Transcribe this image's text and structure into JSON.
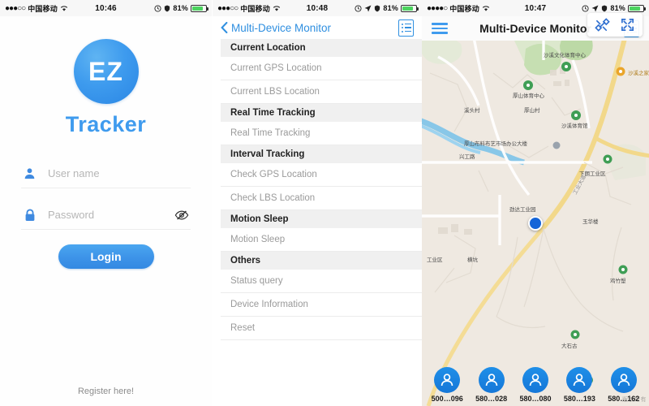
{
  "statusbars": {
    "carrier": "中国移动",
    "battery": "81%",
    "times": {
      "login": "10:46",
      "menu": "10:48",
      "map": "10:47"
    }
  },
  "login": {
    "logo_badge": "EZ",
    "logo_text": "Tracker",
    "username": {
      "placeholder": "User name",
      "value": ""
    },
    "password": {
      "placeholder": "Password",
      "value": ""
    },
    "login_label": "Login",
    "register_label": "Register here!",
    "accent": "#3f9bee"
  },
  "menu": {
    "back_label": "Multi-Device Monitor",
    "sections": [
      {
        "header": "Current Location",
        "items": [
          "Current GPS Location",
          "Current LBS Location"
        ]
      },
      {
        "header": "Real Time Tracking",
        "items": [
          "Real Time Tracking"
        ]
      },
      {
        "header": "Interval Tracking",
        "items": [
          "Check GPS Location",
          "Check LBS Location"
        ]
      },
      {
        "header": "Motion Sleep",
        "items": [
          "Motion Sleep"
        ]
      },
      {
        "header": "Others",
        "items": [
          "Status query",
          "Device Information",
          "Reset"
        ]
      }
    ]
  },
  "map_screen": {
    "title": "Multi-Device Monitor",
    "controls": [
      "satellite-icon",
      "expand-icon"
    ],
    "devices": [
      {
        "label": "500…096"
      },
      {
        "label": "580…028"
      },
      {
        "label": "580…080"
      },
      {
        "label": "580…193"
      },
      {
        "label": "580…162"
      }
    ],
    "labels": [
      "沙溪文化体育中心",
      "沙溪体育馆",
      "厚山体育中心",
      "厚山村",
      "溪头村",
      "厚山布料布艺市场办公大楼",
      "下朗工业区",
      "玉华楼",
      "劲达工业园",
      "工业区",
      "横坑",
      "大石古",
      "鸡竹塱",
      "兴工路",
      "沙溪之家"
    ],
    "watermark": "版权所有"
  }
}
